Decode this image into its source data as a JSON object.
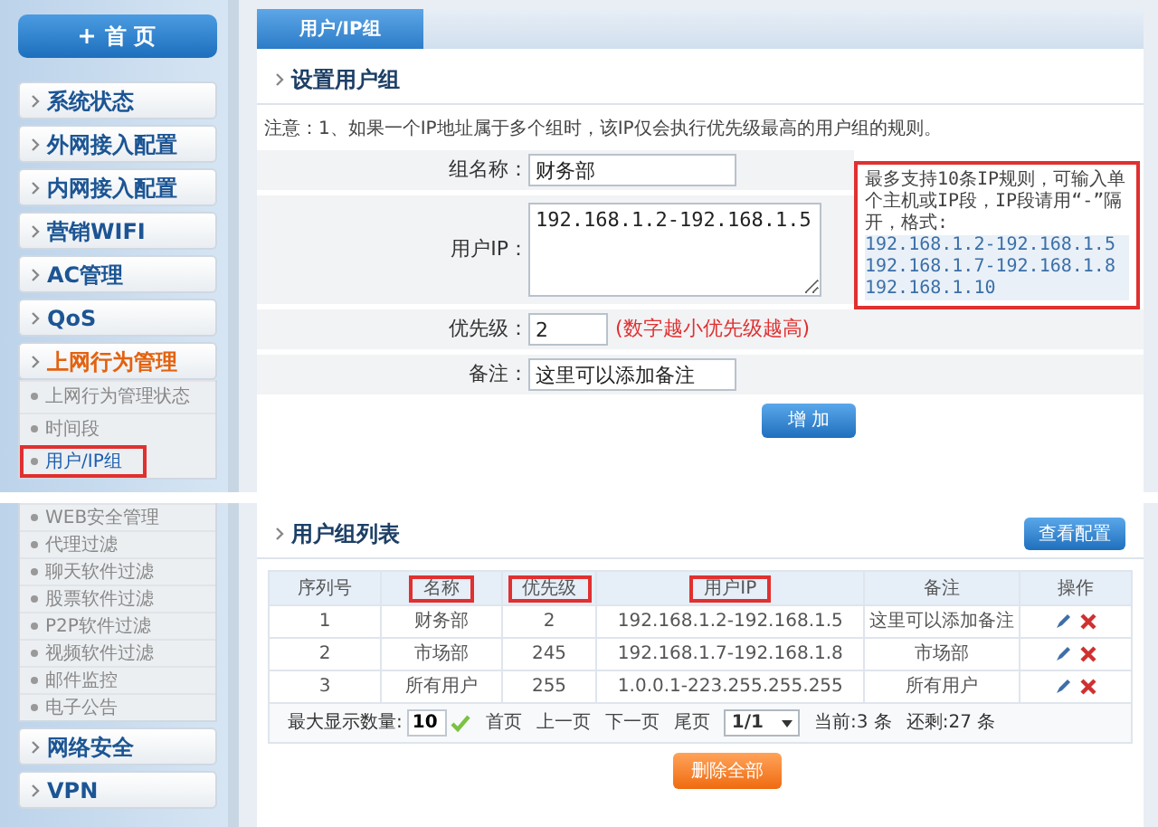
{
  "top_panel": {
    "sidebar": {
      "home_button": "首 页",
      "menu": [
        {
          "label": "系统状态",
          "active": false
        },
        {
          "label": "外网接入配置",
          "active": false
        },
        {
          "label": "内网接入配置",
          "active": false
        },
        {
          "label": "营销WIFI",
          "active": false
        },
        {
          "label": "AC管理",
          "active": false
        },
        {
          "label": "QoS",
          "active": false
        },
        {
          "label": "上网行为管理",
          "active": true,
          "children": [
            {
              "label": "上网行为管理状态",
              "selected": false
            },
            {
              "label": "时间段",
              "selected": false
            },
            {
              "label": "用户/IP组",
              "selected": true
            }
          ]
        }
      ]
    },
    "tabs": [
      {
        "label": "用户/IP组",
        "selected": true
      }
    ],
    "section_title": "设置用户组",
    "note": "注意：1、如果一个IP地址属于多个组时，该IP仅会执行优先级最高的用户组的规则。",
    "form": {
      "group_name": {
        "label": "组名称：",
        "value": "财务部"
      },
      "user_ip": {
        "label": "用户IP：",
        "value": "192.168.1.2-192.168.1.5"
      },
      "priority": {
        "label": "优先级：",
        "value": "2",
        "hint": "(数字越小优先级越高)"
      },
      "remark": {
        "label": "备注：",
        "value": "这里可以添加备注"
      }
    },
    "hint_box": {
      "text": "最多支持10条IP规则，可输入单个主机或IP段，IP段请用“-”隔开，格式:",
      "examples": [
        "192.168.1.2-192.168.1.5",
        "192.168.1.7-192.168.1.8",
        "192.168.1.10"
      ]
    },
    "add_button": "增 加"
  },
  "bottom_panel": {
    "sidebar": {
      "sub_items": [
        "WEB安全管理",
        "代理过滤",
        "聊天软件过滤",
        "股票软件过滤",
        "P2P软件过滤",
        "视频软件过滤",
        "邮件监控",
        "电子公告"
      ],
      "menu": [
        "网络安全",
        "VPN"
      ]
    },
    "section_title": "用户组列表",
    "view_button": "查看配置",
    "table": {
      "columns": [
        {
          "label": "序列号",
          "highlighted": false
        },
        {
          "label": "名称",
          "highlighted": true
        },
        {
          "label": "优先级",
          "highlighted": true
        },
        {
          "label": "用户IP",
          "highlighted": true
        },
        {
          "label": "备注",
          "highlighted": false
        },
        {
          "label": "操作",
          "highlighted": false
        }
      ],
      "rows": [
        [
          "1",
          "财务部",
          "2",
          "192.168.1.2-192.168.1.5",
          "这里可以添加备注"
        ],
        [
          "2",
          "市场部",
          "245",
          "192.168.1.7-192.168.1.8",
          "市场部"
        ],
        [
          "3",
          "所有用户",
          "255",
          "1.0.0.1-223.255.255.255",
          "所有用户"
        ]
      ]
    },
    "pager": {
      "max_label": "最大显示数量:",
      "max_value": "10",
      "links": [
        "首页",
        "上一页",
        "下一页",
        "尾页"
      ],
      "page_select": "1/1",
      "current": "当前:3 条",
      "remaining": "还剩:27 条"
    },
    "delete_all_button": "删除全部"
  }
}
